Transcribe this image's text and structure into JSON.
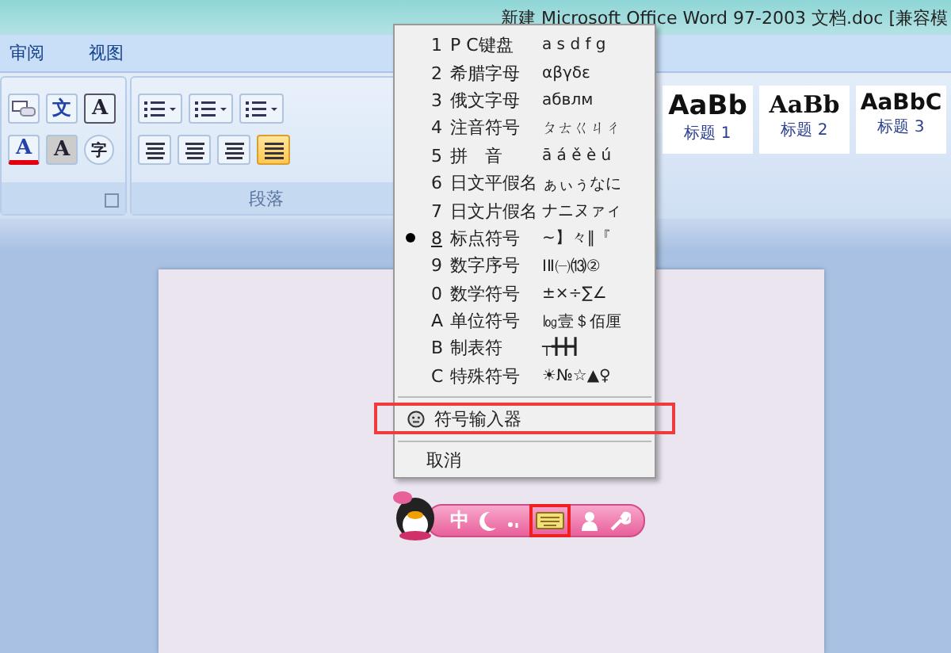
{
  "window": {
    "title": "新建 Microsoft Office Word 97-2003 文档.doc [兼容模"
  },
  "tabs": [
    {
      "label": "审阅",
      "selected": false
    },
    {
      "label": "视图",
      "selected": false
    }
  ],
  "font_group": {
    "row1": [
      {
        "glyph": "文",
        "kind": "phonetic"
      },
      {
        "glyph": "A",
        "kind": "boxed"
      }
    ],
    "row2": [
      {
        "glyph": "A",
        "kind": "color"
      },
      {
        "glyph": "A",
        "kind": "shaded"
      },
      {
        "glyph": "字",
        "kind": "circled"
      }
    ]
  },
  "paragraph_group": {
    "label": "段落",
    "justify_selected": true
  },
  "styles": [
    {
      "sample": "AaBb",
      "label": "标题 1"
    },
    {
      "sample": "AaBb",
      "label": "标题 2"
    },
    {
      "sample": "AaBbC",
      "label": "标题 3"
    }
  ],
  "symbol_menu": {
    "items": [
      {
        "kind": "item",
        "number": "1",
        "label": "P C键盘",
        "sample": "a s d f g",
        "selected": false
      },
      {
        "kind": "item",
        "number": "2",
        "label": "希腊字母",
        "sample": "αβγδε",
        "selected": false
      },
      {
        "kind": "item",
        "number": "3",
        "label": "俄文字母",
        "sample": "абвлм",
        "selected": false
      },
      {
        "kind": "item",
        "number": "4",
        "label": "注音符号",
        "sample": "ㄆㄊㄍㄐㄔ",
        "selected": false
      },
      {
        "kind": "item",
        "number": "5",
        "label": "拼　音",
        "sample": "ā á ě è ú",
        "selected": false
      },
      {
        "kind": "item",
        "number": "6",
        "label": "日文平假名",
        "sample": "ぁぃぅなに",
        "selected": false
      },
      {
        "kind": "item",
        "number": "7",
        "label": "日文片假名",
        "sample": "ナニヌァィ",
        "selected": false
      },
      {
        "kind": "item",
        "number": "8",
        "label": "标点符号",
        "sample": "~】々‖『",
        "selected": true
      },
      {
        "kind": "item",
        "number": "9",
        "label": "数字序号",
        "sample": "ⅠⅡ㈠⒀②",
        "selected": false
      },
      {
        "kind": "item",
        "number": "0",
        "label": "数学符号",
        "sample": "±×÷∑∠",
        "selected": false
      },
      {
        "kind": "item",
        "number": "A",
        "label": "单位符号",
        "sample": "㏒壹＄佰厘",
        "selected": false
      },
      {
        "kind": "item",
        "number": "B",
        "label": "制表符",
        "sample": "┬╋╋┫",
        "selected": false
      },
      {
        "kind": "item",
        "number": "C",
        "label": "特殊符号",
        "sample": "☀№☆▲♀",
        "selected": false
      },
      {
        "kind": "separator"
      },
      {
        "kind": "tool",
        "label": "符号输入器",
        "highlighted": true
      },
      {
        "kind": "separator"
      },
      {
        "kind": "plain",
        "label": "取消"
      }
    ]
  },
  "ime_bar": {
    "mode": "中",
    "keyboard_highlighted": true
  }
}
